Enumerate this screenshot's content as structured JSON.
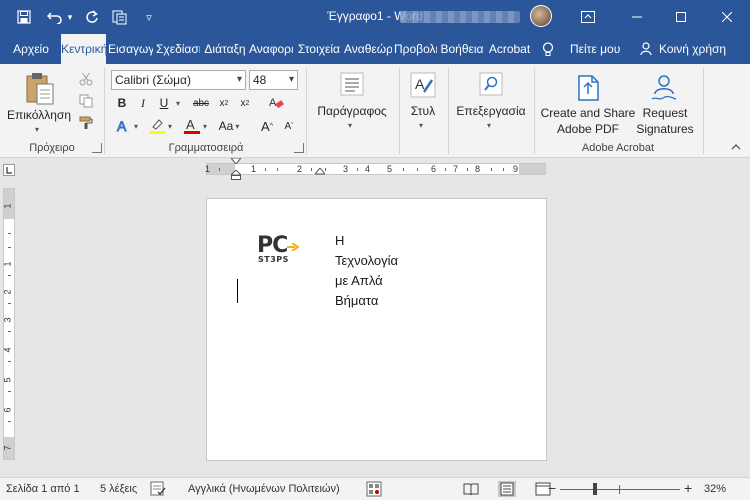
{
  "titlebar": {
    "title": "Έγγραφο1 - Word"
  },
  "tabs": [
    {
      "label": "Αρχείο",
      "active": false
    },
    {
      "label": "Κεντρική",
      "active": true
    },
    {
      "label": "Εισαγωγή",
      "active": false
    },
    {
      "label": "Σχεδίαση",
      "active": false
    },
    {
      "label": "Διάταξη",
      "active": false
    },
    {
      "label": "Αναφορές",
      "active": false
    },
    {
      "label": "Στοιχεία",
      "active": false
    },
    {
      "label": "Αναθεώρηση",
      "active": false
    },
    {
      "label": "Προβολή",
      "active": false
    },
    {
      "label": "Βοήθεια",
      "active": false
    },
    {
      "label": "Acrobat",
      "active": false
    }
  ],
  "tell_me": {
    "label": "Πείτε μου"
  },
  "share": {
    "label": "Κοινή χρήση"
  },
  "ribbon": {
    "clipboard": {
      "group_label": "Πρόχειρο",
      "paste_label": "Επικόλληση"
    },
    "font": {
      "group_label": "Γραμματοσειρά",
      "font_name": "Calibri (Σώμα)",
      "font_size": "48"
    },
    "paragraph": {
      "label": "Παράγραφος"
    },
    "styles": {
      "label": "Στυλ"
    },
    "editing": {
      "label": "Επεξεργασία"
    },
    "acrobat": {
      "group_label": "Adobe Acrobat",
      "create_share_line1": "Create and Share",
      "create_share_line2": "Adobe PDF",
      "request_line1": "Request",
      "request_line2": "Signatures"
    }
  },
  "ruler": {
    "h_numbers": [
      "1",
      "1",
      "2",
      "3",
      "4",
      "5",
      "6",
      "7",
      "8",
      "9"
    ],
    "v_numbers": [
      "1",
      "1",
      "2",
      "3",
      "4",
      "5",
      "6",
      "7"
    ]
  },
  "document": {
    "logo_top": "PC",
    "logo_bottom": "ST3PS",
    "lines": [
      "Η",
      "Τεχνολογία",
      "με Απλά",
      "Βήματα"
    ]
  },
  "status": {
    "page": "Σελίδα 1 από 1",
    "words": "5 λέξεις",
    "language": "Αγγλικά (Ηνωμένων Πολιτειών)",
    "zoom": "32%"
  },
  "colors": {
    "accent": "#2b579a",
    "ribbon_bg": "#f3f3f3",
    "canvas_bg": "#e6e6e6",
    "highlight_yellow": "#ffff00",
    "font_color_red": "#e00000",
    "logo_yellow": "#f2b01e"
  }
}
